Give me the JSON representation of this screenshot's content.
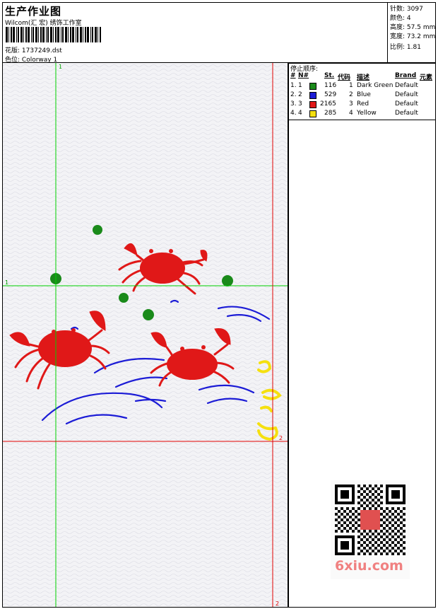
{
  "header": {
    "title": "生产作业图",
    "company": "Wilcom(汇 宏) 绣饰工作室",
    "design_label": "花版:",
    "design_value": "1737249.dst",
    "color_label": "色位:",
    "color_value": "Colorway 1"
  },
  "stats": [
    {
      "label": "针数:",
      "value": "3097"
    },
    {
      "label": "颜色:",
      "value": "4"
    },
    {
      "label": "高度:",
      "value": "57.5 mm"
    },
    {
      "label": "宽度:",
      "value": "73.2 mm"
    },
    {
      "label": "比例:",
      "value": "1.81"
    }
  ],
  "stop_list": {
    "title": "停止顺序:",
    "headers": {
      "hash": "#",
      "no": "N#",
      "stitches": "St.",
      "code": "代码",
      "desc": "描述",
      "brand": "Brand",
      "elem": "元素"
    },
    "rows": [
      {
        "index": "1.",
        "no": "1",
        "color": "#1a8a1a",
        "stitches": "116",
        "code": "1",
        "desc": "Dark Green",
        "brand": "Default"
      },
      {
        "index": "2.",
        "no": "2",
        "color": "#1c1cd6",
        "stitches": "529",
        "code": "2",
        "desc": "Blue",
        "brand": "Default"
      },
      {
        "index": "3.",
        "no": "3",
        "color": "#e01818",
        "stitches": "2165",
        "code": "3",
        "desc": "Red",
        "brand": "Default"
      },
      {
        "index": "4.",
        "no": "4",
        "color": "#f5e010",
        "stitches": "285",
        "code": "4",
        "desc": "Yellow",
        "brand": "Default"
      }
    ]
  },
  "guides": {
    "green_v_label": "1",
    "green_h_label": "1",
    "red_v_label": "2",
    "red_h_label": "2"
  },
  "watermark": "6xiu.com",
  "colors": {
    "green_guide": "#00d000",
    "red_guide": "#e00000",
    "dark_green": "#1a8a1a",
    "blue": "#1c1cd6",
    "red": "#e01818",
    "yellow": "#f5e010"
  }
}
